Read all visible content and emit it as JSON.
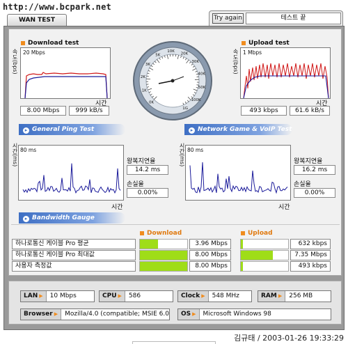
{
  "watermark": "http://www.bcpark.net",
  "header": {
    "tab_title": "WAN TEST",
    "try_again": "Try again",
    "test_name": "테스트 끝"
  },
  "download": {
    "title": "Download test",
    "ylabel": "속도(bps)",
    "top_label": "20 Mbps",
    "xlabel": "시간",
    "value_bps": "8.00 Mbps",
    "value_bytes": "999 kB/s"
  },
  "upload": {
    "title": "Upload test",
    "ylabel": "속도(bps)",
    "top_label": "1 Mbps",
    "xlabel": "시간",
    "value_bps": "493 kbps",
    "value_bytes": "61.6 kB/s"
  },
  "gauge": {
    "ticks": [
      "0",
      "1",
      "2",
      "3",
      "5",
      "10",
      "20",
      "30",
      "40",
      "50",
      "100",
      "1G"
    ],
    "tick_units": [
      "K",
      "K",
      "K",
      "K",
      "K",
      "K",
      "K",
      "K",
      "K",
      "K",
      "K",
      ""
    ]
  },
  "ping": {
    "title": "General Ping Test",
    "ylabel": "시간(ms)",
    "top_label": "80 ms",
    "xlabel": "시간",
    "rtt_label": "왕복지연율",
    "rtt_value": "14.2 ms",
    "loss_label": "손실율",
    "loss_value": "0.00%"
  },
  "game": {
    "title": "Network Game & VoIP Test",
    "ylabel": "시간(ms)",
    "top_label": "80 ms",
    "xlabel": "시간",
    "rtt_label": "왕복지연율",
    "rtt_value": "16.2 ms",
    "loss_label": "손실율",
    "loss_value": "0.00%"
  },
  "bandwidth": {
    "title": "Bandwidth Gauge",
    "col_download": "Download",
    "col_upload": "Upload",
    "rows": [
      {
        "name": "하나로통신 케이블 Pro 평균",
        "down_fraction": 0.38,
        "down": "3.96 Mbps",
        "up_fraction": 0.05,
        "up": "632 kbps"
      },
      {
        "name": "하나로통신 케이블 Pro 최대값",
        "down_fraction": 1.0,
        "down": "8.00 Mbps",
        "up_fraction": 0.68,
        "up": "7.35 Mbps"
      },
      {
        "name": "사용자 측정값",
        "down_fraction": 1.0,
        "down": "8.00 Mbps",
        "up_fraction": 0.04,
        "up": "493 kbps"
      }
    ]
  },
  "sysinfo": {
    "lan_key": "LAN",
    "lan": "10 Mbps",
    "cpu_key": "CPU",
    "cpu": "586",
    "clock_key": "Clock",
    "clock": "548 MHz",
    "ram_key": "RAM",
    "ram": "256 MB",
    "browser_key": "Browser",
    "browser": "Mozilla/4.0 (compatible; MSIE 6.0",
    "os_key": "OS",
    "os": "Microsoft Windows 98"
  },
  "footer": "김규태 / 2003-01-26 19:33:29",
  "colors": {
    "accent": "#f08c1e",
    "bar_fill": "#9fdd18",
    "section_blue": "#3e6fc4",
    "panel_gray": "#9a9a9a"
  }
}
